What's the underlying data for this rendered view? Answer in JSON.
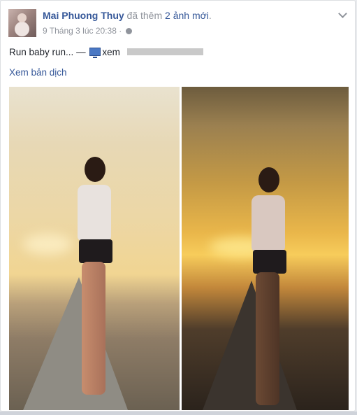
{
  "post": {
    "author": "Mai Phuong Thuy",
    "action_prefix": "đã thêm",
    "action_count": "2 ảnh mới",
    "action_suffix": ".",
    "timestamp": "9 Tháng 3 lúc 20:38",
    "separator": "·",
    "status_text": "Run baby run...",
    "status_dash": "—",
    "activity": "xem",
    "translate_link": "Xem bản dịch"
  },
  "icons": {
    "privacy": "globe-icon",
    "activity": "tv-icon",
    "menu": "chevron-down-icon"
  },
  "colors": {
    "link": "#365899",
    "meta": "#90949c",
    "background": "#e9ebee"
  }
}
